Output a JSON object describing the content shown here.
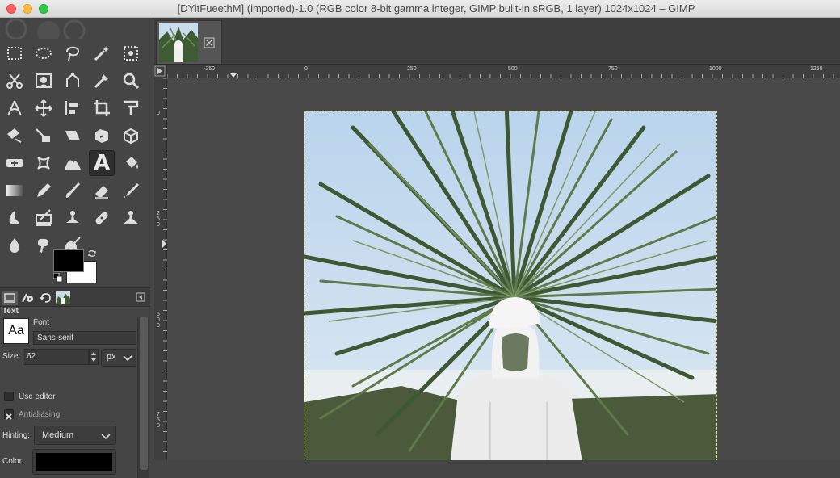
{
  "window": {
    "title": "[DYitFueethM] (imported)-1.0 (RGB color 8-bit gamma integer, GIMP built-in sRGB, 1 layer) 1024x1024 – GIMP"
  },
  "toolbox": {
    "tools": [
      "rect-select-icon",
      "ellipse-select-icon",
      "free-select-icon",
      "fuzzy-select-icon",
      "color-select-icon",
      "scissors-icon",
      "foreground-select-icon",
      "paths-icon",
      "color-picker-icon",
      "zoom-icon",
      "measure-icon",
      "move-icon",
      "align-icon",
      "crop-icon",
      "rotate-icon",
      "scale-icon",
      "shear-icon",
      "perspective-icon",
      "3d-transform-icon",
      "unified-transform-icon",
      "warp-icon",
      "handle-transform-icon",
      "cage-icon",
      "text-icon",
      "bucket-fill-icon",
      "gradient-icon",
      "pencil-icon",
      "paintbrush-icon",
      "eraser-icon",
      "airbrush-icon",
      "ink-icon",
      "mypaint-brush-icon",
      "clone-icon",
      "heal-icon",
      "perspective-clone-icon",
      "blur-icon",
      "smudge-icon",
      "dodge-burn-icon"
    ],
    "active_tool": "text-icon",
    "foreground_color": "#000000",
    "background_color": "#ffffff"
  },
  "dock": {
    "tabs": [
      "tool-options-tab",
      "device-status-tab",
      "undo-history-tab",
      "images-tab"
    ]
  },
  "tool_options": {
    "heading": "Text",
    "font_label": "Font",
    "font_preview": "Aa",
    "font_value": "Sans-serif",
    "size_label": "Size:",
    "size_value": "62",
    "unit_value": "px",
    "use_editor_label": "Use editor",
    "use_editor_checked": false,
    "antialiasing_label": "Antialiasing",
    "antialiasing_checked": true,
    "hinting_label": "Hinting:",
    "hinting_value": "Medium",
    "color_label": "Color:",
    "color_value": "#000000"
  },
  "rulers": {
    "horizontal_labels": [
      "-250",
      "0",
      "250",
      "500",
      "750",
      "1000",
      "1250"
    ],
    "vertical_labels": [
      "0",
      "250",
      "500",
      "750"
    ]
  },
  "colors": {
    "canvas_bg": "#494949",
    "selection_outline": "#e5e07a"
  }
}
